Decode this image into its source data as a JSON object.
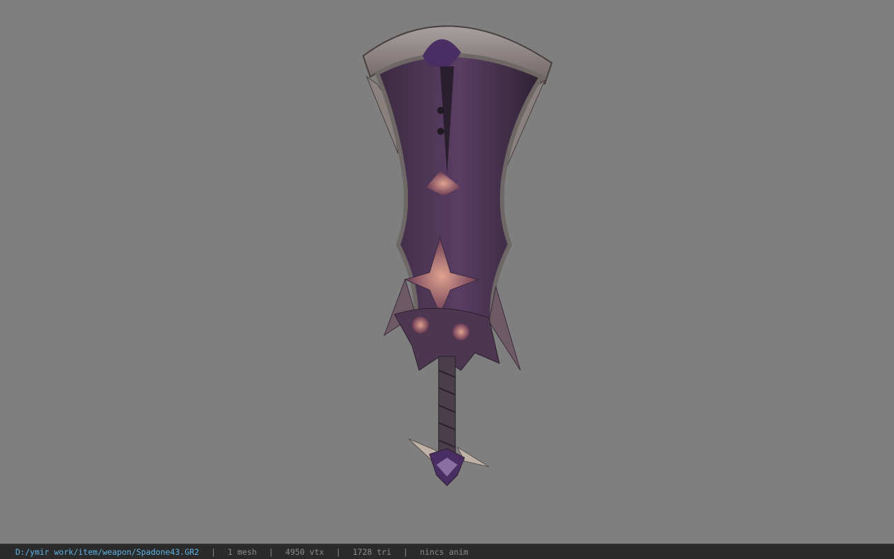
{
  "viewer": {
    "background_color": "#7f7f7f",
    "model_icon": "weapon-model-icon"
  },
  "statusbar": {
    "file_path": "D:/ymir work/item/weapon/Spadone43.GR2",
    "separator": "|",
    "mesh_count": "1 mesh",
    "vertex_count": "4950 vtx",
    "triangle_count": "1728 tri",
    "animation": "nincs anim"
  }
}
